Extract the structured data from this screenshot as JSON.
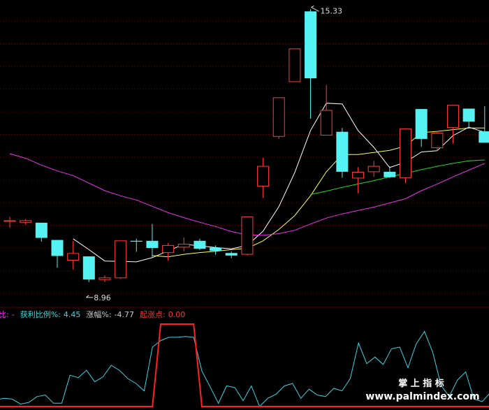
{
  "chart_data": [
    {
      "type": "candlestick",
      "ylim": [
        8.3,
        15.6
      ],
      "grid": true,
      "colors": {
        "up": "#ff3b3b",
        "down": "#54f2f2",
        "ma_short": "#ffffff",
        "ma_mid": "#ffff55",
        "ma_long": "#22dd22",
        "ma_longest": "#ee33ee"
      },
      "annotations": {
        "high_label": "15.33",
        "low_label": "8.96"
      },
      "candles": [
        {
          "o": 10.36,
          "h": 10.45,
          "l": 10.19,
          "c": 10.36
        },
        {
          "o": 10.32,
          "h": 10.4,
          "l": 10.27,
          "c": 10.36
        },
        {
          "o": 10.31,
          "h": 10.31,
          "l": 9.86,
          "c": 9.95
        },
        {
          "o": 9.9,
          "h": 9.9,
          "l": 9.24,
          "c": 9.52
        },
        {
          "o": 9.42,
          "h": 9.88,
          "l": 9.2,
          "c": 9.58
        },
        {
          "o": 9.51,
          "h": 9.51,
          "l": 8.9,
          "c": 8.96
        },
        {
          "o": 8.96,
          "h": 9.06,
          "l": 8.9,
          "c": 9.0
        },
        {
          "o": 9.0,
          "h": 9.88,
          "l": 8.98,
          "c": 9.88
        },
        {
          "o": 9.88,
          "h": 9.93,
          "l": 9.62,
          "c": 9.86
        },
        {
          "o": 9.88,
          "h": 10.28,
          "l": 9.49,
          "c": 9.71
        },
        {
          "o": 9.6,
          "h": 9.83,
          "l": 9.41,
          "c": 9.77
        },
        {
          "o": 9.73,
          "h": 9.96,
          "l": 9.63,
          "c": 9.8
        },
        {
          "o": 9.88,
          "h": 9.93,
          "l": 9.66,
          "c": 9.69
        },
        {
          "o": 9.72,
          "h": 9.77,
          "l": 9.55,
          "c": 9.64
        },
        {
          "o": 9.59,
          "h": 9.63,
          "l": 9.47,
          "c": 9.53
        },
        {
          "o": 9.56,
          "h": 10.45,
          "l": 9.53,
          "c": 10.45
        },
        {
          "o": 11.18,
          "h": 11.85,
          "l": 10.9,
          "c": 11.65
        },
        {
          "o": 12.36,
          "h": 13.28,
          "l": 12.3,
          "c": 13.28
        },
        {
          "o": 13.66,
          "h": 14.44,
          "l": 13.66,
          "c": 14.44
        },
        {
          "o": 15.33,
          "h": 15.38,
          "l": 12.78,
          "c": 13.74
        },
        {
          "o": 12.39,
          "h": 13.58,
          "l": 12.39,
          "c": 12.98
        },
        {
          "o": 12.47,
          "h": 12.56,
          "l": 11.38,
          "c": 11.52
        },
        {
          "o": 11.37,
          "h": 11.63,
          "l": 11.01,
          "c": 11.51
        },
        {
          "o": 11.52,
          "h": 11.78,
          "l": 11.4,
          "c": 11.65
        },
        {
          "o": 11.52,
          "h": 11.65,
          "l": 11.37,
          "c": 11.39
        },
        {
          "o": 11.38,
          "h": 12.53,
          "l": 11.25,
          "c": 12.54
        },
        {
          "o": 13.01,
          "h": 13.01,
          "l": 12.11,
          "c": 12.3
        },
        {
          "o": 12.09,
          "h": 12.49,
          "l": 12.02,
          "c": 12.44
        },
        {
          "o": 12.57,
          "h": 13.1,
          "l": 12.19,
          "c": 13.1
        },
        {
          "o": 13.02,
          "h": 13.02,
          "l": 12.55,
          "c": 12.71
        },
        {
          "o": 12.48,
          "h": 13.08,
          "l": 12.21,
          "c": 12.21
        }
      ],
      "series": [
        {
          "key": "ma_short",
          "values": [
            null,
            null,
            null,
            null,
            9.93,
            9.67,
            9.4,
            9.39,
            9.38,
            9.48,
            9.64,
            9.8,
            9.76,
            9.72,
            9.69,
            9.77,
            10.11,
            10.69,
            11.5,
            12.5,
            13.15,
            13.13,
            12.5,
            12.1,
            11.62,
            11.75,
            11.99,
            12.02,
            12.38,
            12.58,
            12.46
          ]
        },
        {
          "key": "ma_mid",
          "values": [
            null,
            null,
            null,
            null,
            null,
            null,
            null,
            null,
            null,
            9.53,
            9.5,
            9.56,
            9.6,
            9.63,
            9.67,
            9.7,
            9.88,
            10.15,
            10.48,
            10.95,
            11.52,
            11.93,
            11.93,
            11.98,
            12.03,
            12.13,
            12.45,
            12.48,
            12.52,
            12.56,
            12.56
          ]
        },
        {
          "key": "ma_long",
          "values": [
            null,
            null,
            null,
            null,
            null,
            null,
            null,
            null,
            null,
            null,
            null,
            null,
            null,
            null,
            null,
            null,
            null,
            null,
            null,
            10.98,
            11.06,
            11.15,
            11.23,
            11.31,
            11.4,
            11.48,
            11.57,
            11.65,
            11.72,
            11.78,
            11.8
          ]
        },
        {
          "key": "ma_longest",
          "values": [
            11.95,
            11.84,
            11.68,
            11.54,
            11.43,
            11.25,
            11.07,
            10.95,
            10.85,
            10.7,
            10.55,
            10.43,
            10.32,
            10.22,
            10.1,
            10.02,
            10.01,
            10.05,
            10.13,
            10.28,
            10.42,
            10.52,
            10.6,
            10.68,
            10.78,
            10.88,
            11.07,
            11.23,
            11.4,
            11.56,
            11.72
          ]
        }
      ]
    },
    {
      "type": "line",
      "ylim": [
        0,
        100
      ],
      "colors": {
        "primary": "#3ad6e6",
        "secondary": "#ff2020"
      },
      "legend": [
        {
          "label": "比:",
          "value": "-",
          "color": "#ff33ff"
        },
        {
          "label": "获利比例%:",
          "value": "4.45",
          "color": "#33dddd"
        },
        {
          "label": "涨幅%:",
          "value": "-4.77",
          "color": "#cccccc"
        },
        {
          "label": "起涨点:",
          "value": "0.00",
          "color": "#ff3333"
        }
      ],
      "series": [
        {
          "key": "profit",
          "values": [
            8,
            10,
            9,
            3,
            5,
            12,
            14,
            4,
            4,
            38,
            35,
            44,
            30,
            36,
            50,
            44,
            34,
            28,
            19,
            72,
            80,
            84,
            84,
            85,
            84,
            43,
            24,
            4,
            25,
            23,
            7,
            25,
            0,
            10,
            15,
            25,
            28,
            10,
            21,
            14,
            12,
            22,
            19,
            34,
            77,
            52,
            60,
            51,
            70,
            72,
            47,
            76,
            91,
            66,
            26,
            12,
            32,
            42,
            9,
            6,
            17,
            50
          ]
        },
        {
          "key": "trigger",
          "values": [
            0,
            0,
            0,
            0,
            0,
            0,
            0,
            0,
            0,
            0,
            0,
            0,
            0,
            0,
            0,
            0,
            0,
            0,
            0,
            0,
            100,
            100,
            100,
            100,
            100,
            0,
            0,
            0,
            0,
            0,
            0,
            0,
            0,
            0,
            0,
            0,
            0,
            0,
            0,
            0,
            0,
            0,
            0,
            0,
            0,
            0,
            0,
            0,
            0,
            0,
            0,
            0,
            0,
            0,
            0,
            0,
            0,
            0,
            0,
            0,
            0,
            0
          ]
        }
      ]
    }
  ],
  "watermark": {
    "line1": "掌 上 指 标",
    "line2": "www.palmindex.com"
  }
}
